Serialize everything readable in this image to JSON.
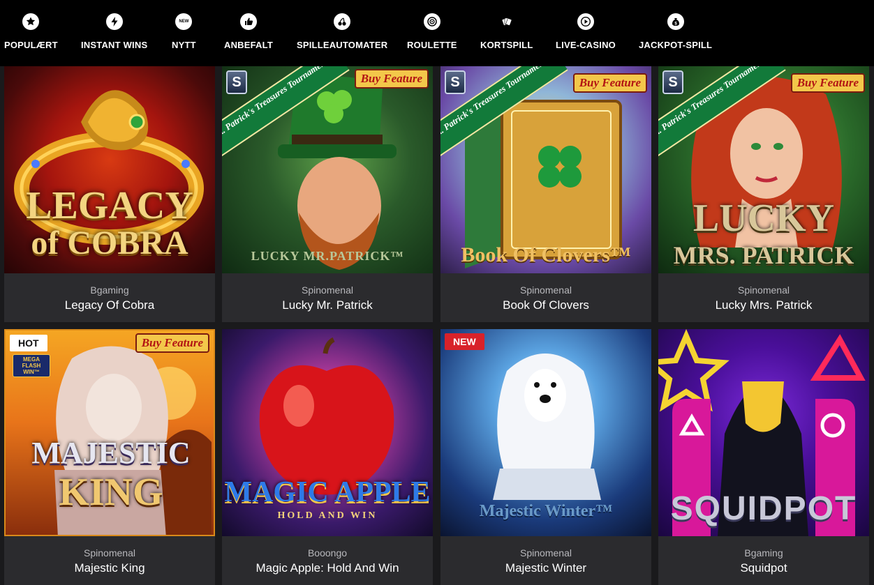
{
  "nav": [
    {
      "label": "POPULÆRT",
      "icon": "star-icon",
      "glyph": "★"
    },
    {
      "label": "INSTANT WINS",
      "icon": "lightning-icon",
      "glyph": "⚡"
    },
    {
      "label": "NYTT",
      "icon": "new-icon",
      "glyph": "NEW"
    },
    {
      "label": "ANBEFALT",
      "icon": "thumbs-up-icon",
      "glyph": "👍"
    },
    {
      "label": "SPILLEAUTOMATER",
      "icon": "cherry-icon",
      "glyph": "🍒"
    },
    {
      "label": "ROULETTE",
      "icon": "roulette-icon",
      "glyph": "◎"
    },
    {
      "label": "KORTSPILL",
      "icon": "cards-icon",
      "glyph": "🂡"
    },
    {
      "label": "LIVE-CASINO",
      "icon": "play-icon",
      "glyph": "▶"
    },
    {
      "label": "JACKPOT-SPILL",
      "icon": "money-bag-icon",
      "glyph": "$"
    }
  ],
  "games": [
    {
      "provider": "Bgaming",
      "title": "Legacy Of Cobra",
      "logo_lines": [
        "LEGACY",
        "of COBRA"
      ]
    },
    {
      "provider": "Spinomenal",
      "title": "Lucky Mr. Patrick",
      "logo_lines": [
        "LUCKY MR.PATRICK™"
      ],
      "buy_feature": "Buy Feature",
      "ribbon": "St. Patrick's Treasures Tournament",
      "provider_badge": "S"
    },
    {
      "provider": "Spinomenal",
      "title": "Book Of Clovers",
      "logo_lines": [
        "Book Of Clovers™"
      ],
      "buy_feature": "Buy Feature",
      "ribbon": "St. Patrick's Treasures Tournament",
      "provider_badge": "S"
    },
    {
      "provider": "Spinomenal",
      "title": "Lucky Mrs. Patrick",
      "logo_lines": [
        "LUCKY",
        "MRS. PATRICK"
      ],
      "buy_feature": "Buy Feature",
      "ribbon": "St. Patrick's Treasures Tournament",
      "provider_badge": "S"
    },
    {
      "provider": "Spinomenal",
      "title": "Majestic King",
      "logo_lines": [
        "MAJESTIC",
        "KING"
      ],
      "buy_feature": "Buy Feature",
      "badge": "HOT",
      "sub_badge": "MEGA FLASH WIN™"
    },
    {
      "provider": "Booongo",
      "title": "Magic Apple: Hold And Win",
      "logo_lines": [
        "MAGIC APPLE",
        "HOLD AND WIN"
      ]
    },
    {
      "provider": "Spinomenal",
      "title": "Majestic Winter",
      "logo_lines": [
        "Majestic Winter™"
      ],
      "badge": "NEW"
    },
    {
      "provider": "Bgaming",
      "title": "Squidpot",
      "logo_lines": [
        "SQUIDPOT"
      ]
    }
  ],
  "colors": {
    "background": "#1a1a1c",
    "nav_background": "#000000",
    "tile_meta": "#2b2b2e",
    "hot_badge": "#ffffff",
    "new_badge": "#d8222a",
    "buy_feature_bg": "#f3c74a",
    "buy_feature_text": "#b21414"
  }
}
